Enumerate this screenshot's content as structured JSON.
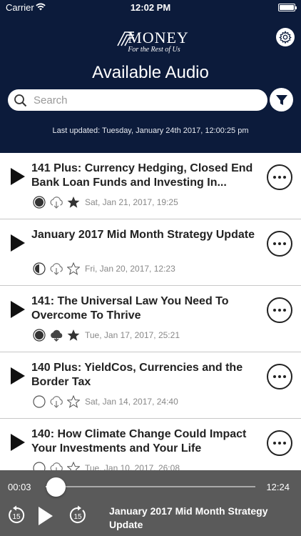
{
  "status_bar": {
    "carrier": "Carrier",
    "time": "12:02 PM"
  },
  "header": {
    "logo_word": "MONEY",
    "logo_tagline": "For the Rest of Us",
    "title": "Available Audio",
    "search_placeholder": "Search",
    "last_updated": "Last updated: Tuesday, January 24th 2017, 12:00:25 pm"
  },
  "episodes": [
    {
      "title": "141 Plus: Currency Hedging, Closed End Bank Loan Funds and Investing In...",
      "progress": "complete",
      "download": "available",
      "favorite": true,
      "date": "Sat, Jan 21, 2017, 19:25"
    },
    {
      "title": "January 2017 Mid Month Strategy Update",
      "progress": "half",
      "download": "available",
      "favorite": false,
      "date": "Fri, Jan 20, 2017, 12:23"
    },
    {
      "title": "141: The Universal Law You Need To Overcome To Thrive",
      "progress": "complete",
      "download": "downloaded",
      "favorite": true,
      "date": "Tue, Jan 17, 2017, 25:21"
    },
    {
      "title": "140 Plus: YieldCos, Currencies and the Border Tax",
      "progress": "unplayed",
      "download": "available",
      "favorite": false,
      "date": "Sat, Jan 14, 2017, 24:40"
    },
    {
      "title": "140: How Climate Change Could Impact Your Investments and Your Life",
      "progress": "unplayed",
      "download": "available",
      "favorite": false,
      "date": "Tue, Jan 10, 2017, 26:08"
    }
  ],
  "player": {
    "elapsed": "00:03",
    "duration": "12:24",
    "position_fraction": 0.004,
    "now_playing": "January 2017 Mid Month Strategy Update",
    "skip_back_seconds": "15",
    "skip_forward_seconds": "15"
  },
  "colors": {
    "header_bg": "#0c1b3b",
    "player_bg": "#5a5a5a",
    "text_dark": "#222222",
    "meta_gray": "#888888"
  }
}
